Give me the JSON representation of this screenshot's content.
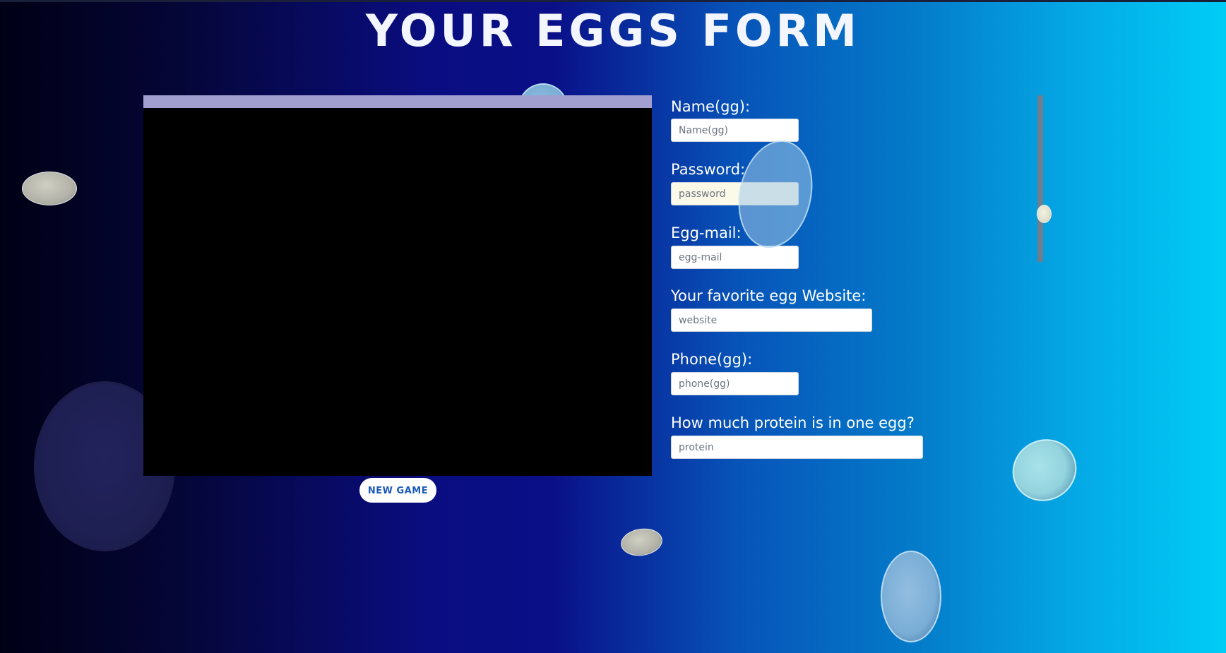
{
  "page": {
    "title": "YOUR EGGS FORM"
  },
  "game": {
    "new_game_label": "NEW GAME"
  },
  "form": {
    "fields": [
      {
        "label": "Name(gg):",
        "placeholder": "Name(gg)",
        "value": ""
      },
      {
        "label": "Password:",
        "placeholder": "password",
        "value": ""
      },
      {
        "label": "Egg-mail:",
        "placeholder": "egg-mail",
        "value": ""
      },
      {
        "label": "Your favorite egg Website:",
        "placeholder": "website",
        "value": ""
      },
      {
        "label": "Phone(gg):",
        "placeholder": "phone(gg)",
        "value": ""
      },
      {
        "label": "How much protein is in one egg?",
        "placeholder": "protein",
        "value": ""
      }
    ]
  },
  "slider": {
    "level": 0.7
  },
  "colors": {
    "background_left": "#000015",
    "background_mid": "#0a0d80",
    "background_right": "#00cdf6",
    "game_bar": "#a19fd0",
    "game_canvas": "#000000",
    "button_text": "#1b5ab8",
    "title_text": "#f4f6ff"
  }
}
